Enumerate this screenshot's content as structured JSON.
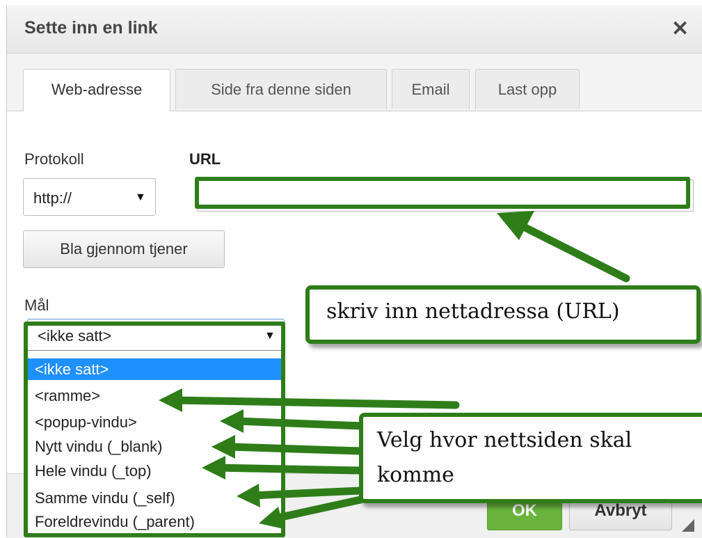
{
  "dialog": {
    "title": "Sette inn en link",
    "close_icon": "close-icon"
  },
  "tabs": [
    {
      "label": "Web-adresse",
      "active": true
    },
    {
      "label": "Side fra denne siden",
      "active": false
    },
    {
      "label": "Email",
      "active": false
    },
    {
      "label": "Last opp",
      "active": false
    }
  ],
  "form": {
    "protocol_label": "Protokoll",
    "protocol_value": "http://",
    "url_label": "URL",
    "url_value": "",
    "browse_button": "Bla gjennom tjener",
    "target_label": "Mål",
    "target_value": "<ikke satt>",
    "target_options": [
      "<ikke satt>",
      "<ramme>",
      "<popup-vindu>",
      "Nytt vindu (_blank)",
      "Hele vindu (_top)",
      "Samme vindu (_self)",
      "Foreldrevindu (_parent)"
    ]
  },
  "footer": {
    "ok_label": "OK",
    "cancel_label": "Avbryt"
  },
  "annotations": {
    "url_callout": "skriv inn nettadressa (URL)",
    "target_callout_line1": "Velg hvor nettsiden skal",
    "target_callout_line2": "komme"
  },
  "colors": {
    "annotation_green": "#2e7d19",
    "selected_option": "#1e90ff",
    "ok_button": "#6ab43e"
  }
}
